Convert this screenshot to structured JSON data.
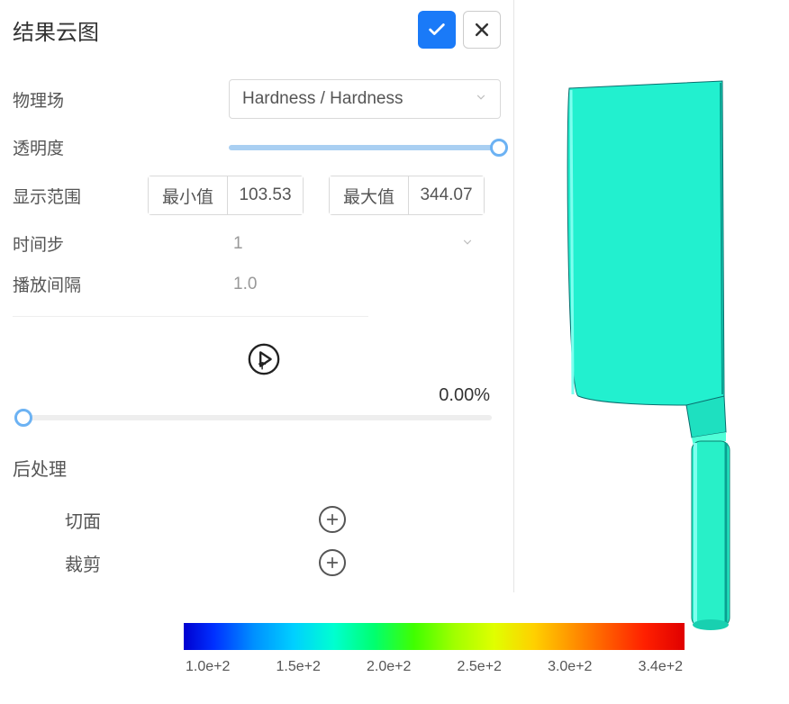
{
  "panel": {
    "title": "结果云图",
    "fields": {
      "physics_label": "物理场",
      "physics_value": "Hardness / Hardness",
      "transparency_label": "透明度",
      "range_label": "显示范围",
      "range_min_label": "最小值",
      "range_min_value": "103.53",
      "range_max_label": "最大值",
      "range_max_value": "344.07",
      "timestep_label": "时间步",
      "timestep_value": "1",
      "interval_label": "播放间隔",
      "interval_value": "1.0",
      "progress_pct": "0.00%"
    },
    "postprocess": {
      "title": "后处理",
      "section_cut": "切面",
      "section_clip": "裁剪"
    }
  },
  "colorbar": {
    "ticks": [
      "1.0e+2",
      "1.5e+2",
      "2.0e+2",
      "2.5e+2",
      "3.0e+2",
      "3.4e+2"
    ]
  },
  "icons": {
    "confirm": "check-icon",
    "close": "close-icon",
    "chevron": "chevron-down-icon",
    "play": "play-icon",
    "add": "plus-icon"
  }
}
